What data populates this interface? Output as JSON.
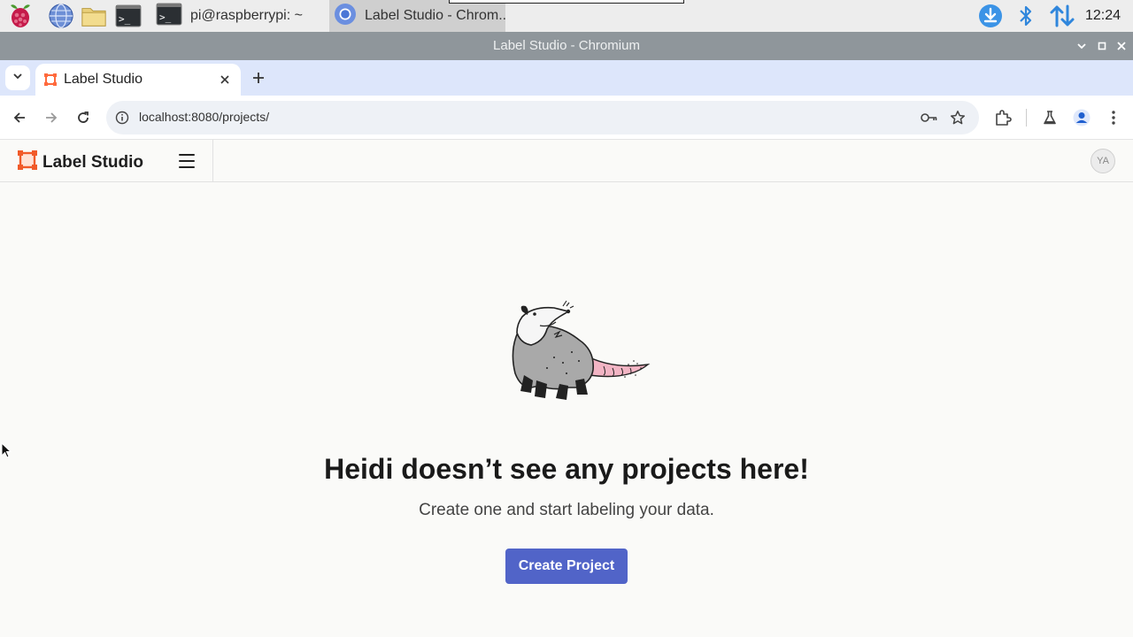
{
  "taskbar": {
    "tasks": [
      {
        "label": "pi@raspberrypi: ~",
        "icon": "terminal-icon"
      },
      {
        "label": "Label Studio - Chrom..",
        "icon": "chromium-icon"
      }
    ],
    "clock": "12:24"
  },
  "window": {
    "title": "Label Studio - Chromium"
  },
  "browser": {
    "tab_title": "Label Studio",
    "url": "localhost:8080/projects/"
  },
  "app": {
    "brand": "Label Studio",
    "user_initials": "YA",
    "accent_color": "#5164c8"
  },
  "empty_state": {
    "title": "Heidi doesn’t see any projects here!",
    "subtitle": "Create one and start labeling your data.",
    "button": "Create Project"
  }
}
